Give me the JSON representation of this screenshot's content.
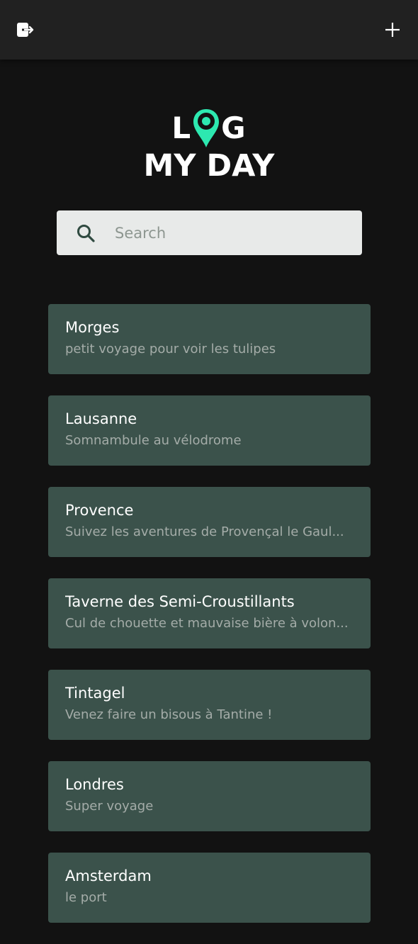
{
  "header": {
    "logout_icon": "logout-icon",
    "add_icon": "plus-icon"
  },
  "logo": {
    "line1_left": "L",
    "line1_right": "G",
    "line2": "MY DAY",
    "pin_color": "#2de8b0"
  },
  "search": {
    "placeholder": "Search",
    "value": ""
  },
  "entries": [
    {
      "title": "Morges",
      "description": "petit voyage pour voir les tulipes"
    },
    {
      "title": "Lausanne",
      "description": "Somnambule au vélodrome"
    },
    {
      "title": "Provence",
      "description": "Suivez les aventures de Provençal le Gaul..."
    },
    {
      "title": "Taverne des Semi-Croustillants",
      "description": "Cul de chouette et mauvaise bière à volon..."
    },
    {
      "title": "Tintagel",
      "description": "Venez faire un bisous à Tantine !"
    },
    {
      "title": "Londres",
      "description": "Super voyage"
    },
    {
      "title": "Amsterdam",
      "description": "le port"
    }
  ],
  "colors": {
    "background": "#121212",
    "header": "#212121",
    "card": "#3b524b",
    "accent": "#2de8b0"
  }
}
